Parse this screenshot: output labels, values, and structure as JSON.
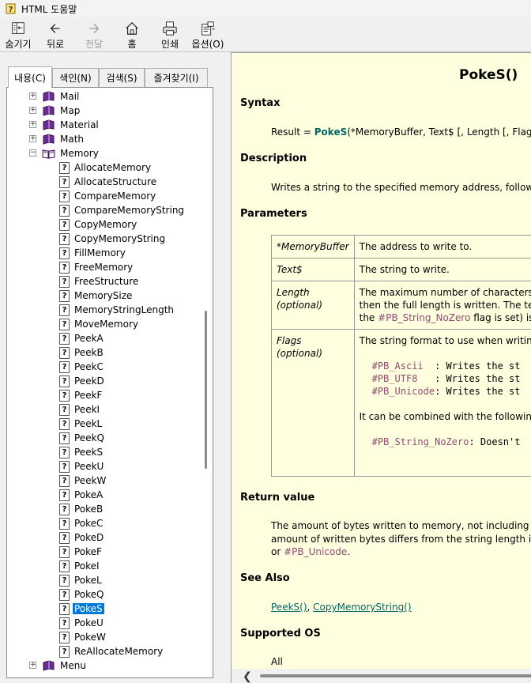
{
  "window": {
    "title": "HTML 도움말"
  },
  "toolbar": {
    "hide": "숨기기",
    "back": "뒤로",
    "forward": "전달",
    "home": "홈",
    "print": "인쇄",
    "options": "옵션(O)"
  },
  "tabs": {
    "contents": "내용(C)",
    "index": "색인(N)",
    "search": "검색(S)",
    "favorites": "즐겨찾기(I)"
  },
  "tree": {
    "books_top": [
      "Mail",
      "Map",
      "Material",
      "Math"
    ],
    "open_book": "Memory",
    "pages": [
      "AllocateMemory",
      "AllocateStructure",
      "CompareMemory",
      "CompareMemoryString",
      "CopyMemory",
      "CopyMemoryString",
      "FillMemory",
      "FreeMemory",
      "FreeStructure",
      "MemorySize",
      "MemoryStringLength",
      "MoveMemory",
      "PeekA",
      "PeekB",
      "PeekC",
      "PeekD",
      "PeekF",
      "PeekI",
      "PeekL",
      "PeekQ",
      "PeekS",
      "PeekU",
      "PeekW",
      "PokeA",
      "PokeB",
      "PokeC",
      "PokeD",
      "PokeF",
      "PokeI",
      "PokeL",
      "PokeQ",
      "PokeS",
      "PokeU",
      "PokeW",
      "ReAllocateMemory"
    ],
    "selected": "PokeS",
    "book_bottom": "Menu"
  },
  "content": {
    "title": "PokeS()",
    "syntax_heading": "Syntax",
    "syntax_prefix": "Result = ",
    "syntax_func": "PokeS",
    "syntax_args": "(*MemoryBuffer, Text$ [, Length [, Flags]",
    "description_heading": "Description",
    "description": "Writes a string to the specified memory address, followed",
    "parameters_heading": "Parameters",
    "params": [
      {
        "name": "*MemoryBuffer",
        "desc": "The address to write to."
      },
      {
        "name": "Text$",
        "desc": "The string to write."
      },
      {
        "name": "Length",
        "optional": "(optional)",
        "desc1": "The maximum number of characters to",
        "desc2": "then the full length is written. The term",
        "desc3_const": "#PB_String_NoZero",
        "desc3_rest": " flag is set) is n"
      },
      {
        "name": "Flags",
        "optional": "(optional)",
        "desc": "The string format to use when writing t",
        "flags": [
          {
            "const": "#PB_Ascii",
            "rest": "  : Writes the st"
          },
          {
            "const": "#PB_UTF8",
            "rest": "   : Writes the st"
          },
          {
            "const": "#PB_Unicode",
            "rest": ": Writes the st"
          }
        ],
        "combine": "It can be combined with the following c",
        "extra_const": "#PB_String_NoZero",
        "extra_rest": ": Doesn't"
      }
    ],
    "return_heading": "Return value",
    "return_line1": "The amount of bytes written to memory, not including the",
    "return_line2": "amount of written bytes differs from the string length in ch",
    "return_line3_prefix": "or ",
    "return_line3_const": "#PB_Unicode",
    "return_line3_suffix": ".",
    "see_also_heading": "See Also",
    "see_also_1": "PeekS()",
    "see_also_sep": ", ",
    "see_also_2": "CopyMemoryString()",
    "os_heading": "Supported OS",
    "os": "All"
  }
}
